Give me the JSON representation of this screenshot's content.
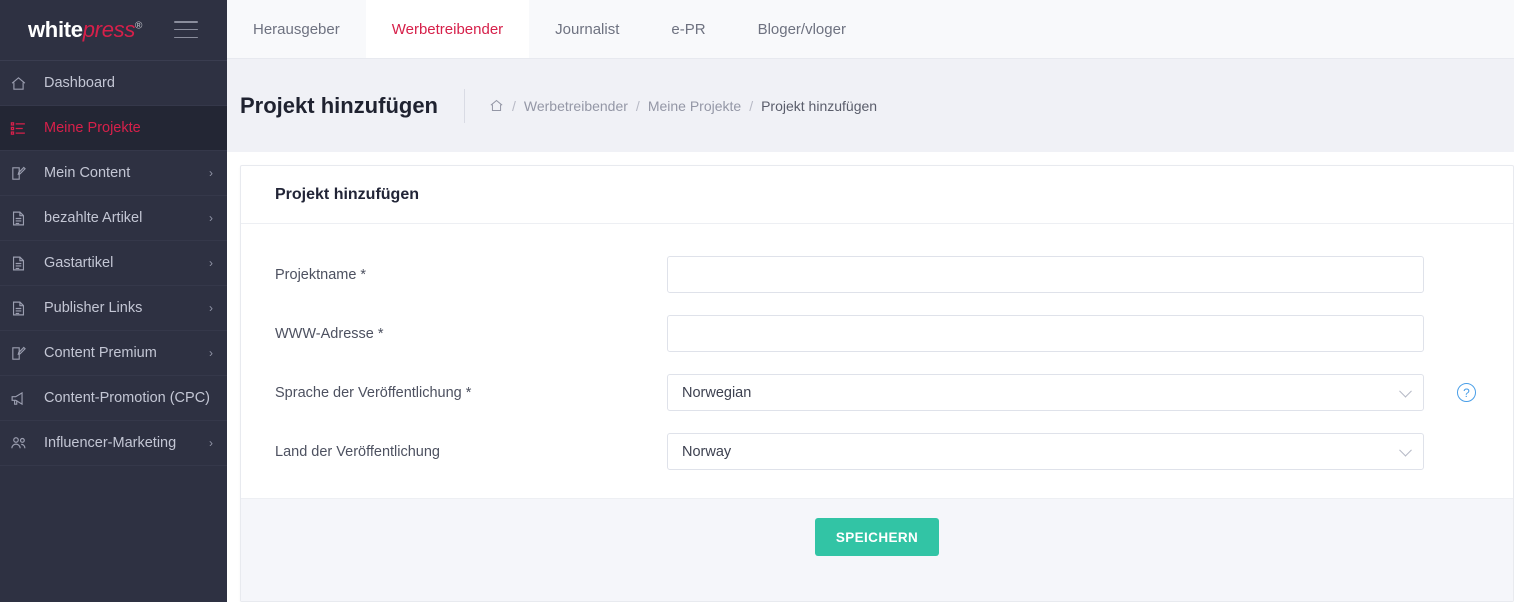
{
  "brand": {
    "name_part1": "white",
    "name_part2": "press",
    "trademark": "®",
    "menu_icon": "hamburger-icon"
  },
  "sidebar": {
    "items": [
      {
        "label": "Dashboard",
        "icon": "home-icon",
        "active": false,
        "has_chevron": false
      },
      {
        "label": "Meine Projekte",
        "icon": "list-icon",
        "active": true,
        "has_chevron": false
      },
      {
        "label": "Mein Content",
        "icon": "edit-icon",
        "active": false,
        "has_chevron": true
      },
      {
        "label": "bezahlte Artikel",
        "icon": "document-icon",
        "active": false,
        "has_chevron": true
      },
      {
        "label": "Gastartikel",
        "icon": "document-icon",
        "active": false,
        "has_chevron": true
      },
      {
        "label": "Publisher Links",
        "icon": "document-icon",
        "active": false,
        "has_chevron": true
      },
      {
        "label": "Content Premium",
        "icon": "edit-icon",
        "active": false,
        "has_chevron": true
      },
      {
        "label": "Content-Promotion (CPC)",
        "icon": "megaphone-icon",
        "active": false,
        "has_chevron": false
      },
      {
        "label": "Influencer-Marketing",
        "icon": "users-icon",
        "active": false,
        "has_chevron": true
      }
    ]
  },
  "tabs": [
    {
      "label": "Herausgeber",
      "active": false
    },
    {
      "label": "Werbetreibender",
      "active": true
    },
    {
      "label": "Journalist",
      "active": false
    },
    {
      "label": "e-PR",
      "active": false
    },
    {
      "label": "Bloger/vloger",
      "active": false
    }
  ],
  "page": {
    "title": "Projekt hinzufügen",
    "breadcrumb": {
      "home_icon": "home-icon",
      "items": [
        "Werbetreibender",
        "Meine Projekte",
        "Projekt hinzufügen"
      ],
      "separator": "/"
    }
  },
  "card": {
    "header": "Projekt hinzufügen",
    "fields": [
      {
        "label": "Projektname *",
        "type": "text",
        "value": "",
        "placeholder": ""
      },
      {
        "label": "WWW-Adresse *",
        "type": "text",
        "value": "",
        "placeholder": ""
      },
      {
        "label": "Sprache der Veröffentlichung *",
        "type": "select",
        "value": "Norwegian",
        "help": "?"
      },
      {
        "label": "Land der Veröffentlichung",
        "type": "select",
        "value": "Norway"
      }
    ],
    "save_label": "SPEICHERN"
  },
  "colors": {
    "accent_pink": "#d6204a",
    "sidebar_bg": "#2e3142",
    "sidebar_active_bg": "#232634",
    "save_green": "#32c4a5",
    "help_blue": "#4a9fe8"
  }
}
